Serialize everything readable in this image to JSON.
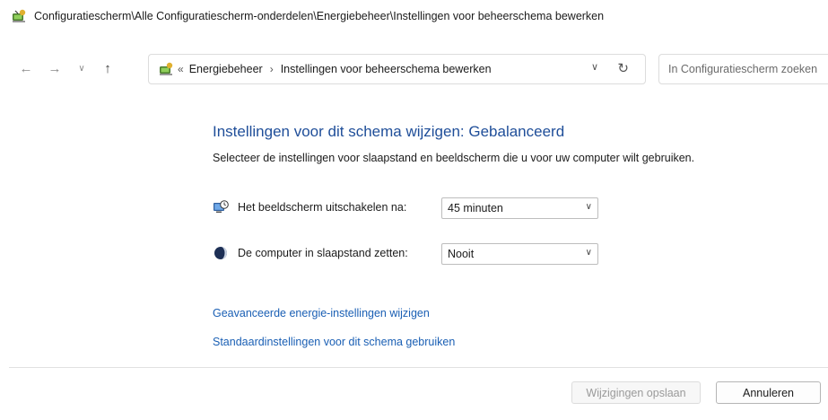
{
  "window": {
    "title": "Configuratiescherm\\Alle Configuratiescherm-onderdelen\\Energiebeheer\\Instellingen voor beheerschema bewerken",
    "icon": "control-panel-icon"
  },
  "navigation": {
    "back_icon": "←",
    "forward_icon": "→",
    "recent_icon": "∨",
    "up_icon": "↑",
    "overflow_chevron": "«",
    "breadcrumbs": [
      "Energiebeheer",
      "Instellingen voor beheerschema bewerken"
    ],
    "crumb_separator": "›",
    "dropdown_icon": "∨",
    "refresh_icon": "↻",
    "search_placeholder": "In Configuratiescherm zoeken"
  },
  "main": {
    "heading": "Instellingen voor dit schema wijzigen: Gebalanceerd",
    "subheading": "Selecteer de instellingen voor slaapstand en beeldscherm die u voor uw computer wilt gebruiken.",
    "settings": [
      {
        "label": "Het beeldscherm uitschakelen na:",
        "value": "45 minuten",
        "icon": "monitor-clock-icon"
      },
      {
        "label": "De computer in slaapstand zetten:",
        "value": "Nooit",
        "icon": "moon-icon"
      }
    ],
    "links": [
      "Geavanceerde energie-instellingen wijzigen",
      "Standaardinstellingen voor dit schema gebruiken"
    ]
  },
  "footer": {
    "save_label": "Wijzigingen opslaan",
    "cancel_label": "Annuleren"
  },
  "colors": {
    "heading": "#1f4e99",
    "link": "#1a5fb4"
  }
}
